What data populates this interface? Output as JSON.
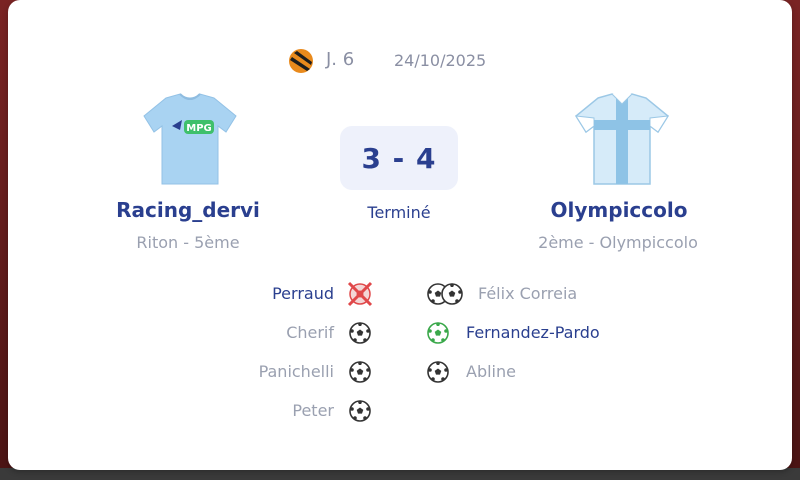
{
  "match": {
    "round": "J. 6",
    "date": "24/10/2025",
    "league_icon": "league-logo-icon",
    "score": "3 - 4",
    "status": "Terminé"
  },
  "home": {
    "name": "Racing_dervi",
    "subtitle": "Riton - 5ème",
    "jersey_badge": "MPG",
    "jersey_color": "#a9d3f2",
    "scorers": [
      {
        "name": "Perraud",
        "icon": "own-goal-cancelled-icon",
        "highlight": true
      },
      {
        "name": "Cherif",
        "icon": "soccer-ball-icon",
        "highlight": false
      },
      {
        "name": "Panichelli",
        "icon": "soccer-ball-icon",
        "highlight": false
      },
      {
        "name": "Peter",
        "icon": "soccer-ball-icon",
        "highlight": false
      }
    ]
  },
  "away": {
    "name": "Olympiccolo",
    "subtitle": "2ème - Olympiccolo",
    "jersey_color": "#cfe6f7",
    "scorers": [
      {
        "name": "Félix Correia",
        "icon": "double-ball-icon",
        "highlight": false
      },
      {
        "name": "Fernandez-Pardo",
        "icon": "green-ball-icon",
        "highlight": true
      },
      {
        "name": "Abline",
        "icon": "soccer-ball-icon",
        "highlight": false
      }
    ]
  },
  "colors": {
    "accent": "#2a3f8f",
    "muted": "#9aa0b0",
    "score_bg": "#eef1fb",
    "own_goal_red": "#e0484a",
    "green_ball": "#3aa84a"
  }
}
